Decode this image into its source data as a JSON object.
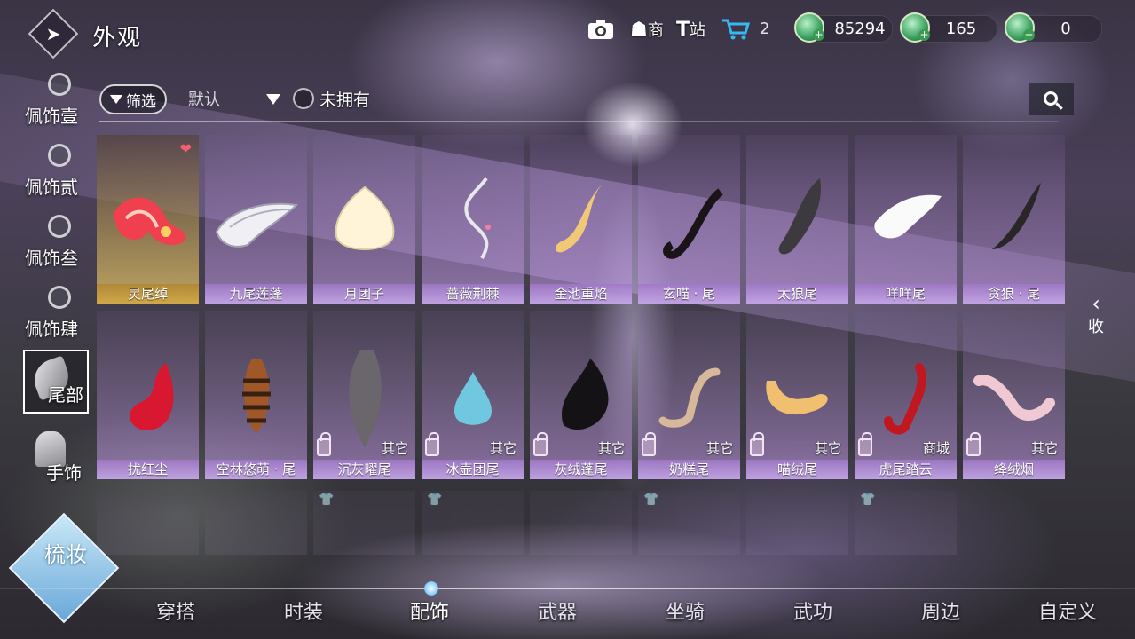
{
  "header": {
    "back_icon": "arrow-back-icon",
    "title": "外观",
    "shop_label": "商",
    "station_label": "站",
    "cart_count": "2",
    "currencies": [
      {
        "value": "85294",
        "icon": "jade-coin-icon"
      },
      {
        "value": "165",
        "icon": "jade-coin-icon"
      },
      {
        "value": "0",
        "icon": "jade-coin-icon"
      }
    ]
  },
  "sidebar": {
    "items": [
      {
        "label": "佩饰壹"
      },
      {
        "label": "佩饰贰"
      },
      {
        "label": "佩饰叁"
      },
      {
        "label": "佩饰肆"
      },
      {
        "label": "尾部",
        "active": true
      },
      {
        "label": "手饰"
      }
    ]
  },
  "filter": {
    "filter_label": "筛选",
    "sort_value": "默认",
    "unowned_label": "未拥有"
  },
  "items_row1": [
    {
      "name": "灵尾绰"
    },
    {
      "name": "九尾莲蓬"
    },
    {
      "name": "月团子"
    },
    {
      "name": "蔷薇荆棘"
    },
    {
      "name": "金池重焰"
    },
    {
      "name": "玄喵 · 尾"
    },
    {
      "name": "太狼尾"
    },
    {
      "name": "咩咩尾"
    },
    {
      "name": "贪狼 · 尾"
    }
  ],
  "items_row2": [
    {
      "name": "扰红尘",
      "source": ""
    },
    {
      "name": "空林悠萌 · 尾",
      "source": ""
    },
    {
      "name": "沉灰曜尾",
      "source": "其它"
    },
    {
      "name": "冰壶团尾",
      "source": "其它"
    },
    {
      "name": "灰绒蓬尾",
      "source": "其它"
    },
    {
      "name": "奶糕尾",
      "source": "其它"
    },
    {
      "name": "喵绒尾",
      "source": "其它"
    },
    {
      "name": "虎尾踏云",
      "source": "商城"
    },
    {
      "name": "绛绒烟",
      "source": "其它"
    }
  ],
  "collapse_label": "收",
  "makeup_label": "梳妆",
  "bottom_tabs": [
    {
      "label": "穿搭"
    },
    {
      "label": "时装"
    },
    {
      "label": "配饰",
      "active": true
    },
    {
      "label": "武器"
    },
    {
      "label": "坐骑"
    },
    {
      "label": "武功"
    },
    {
      "label": "周边"
    },
    {
      "label": "自定义"
    }
  ],
  "colors": {
    "selected_gold": "#d0a848",
    "card_lavender": "#c8a8e8",
    "coin_green": "#3aa060"
  }
}
